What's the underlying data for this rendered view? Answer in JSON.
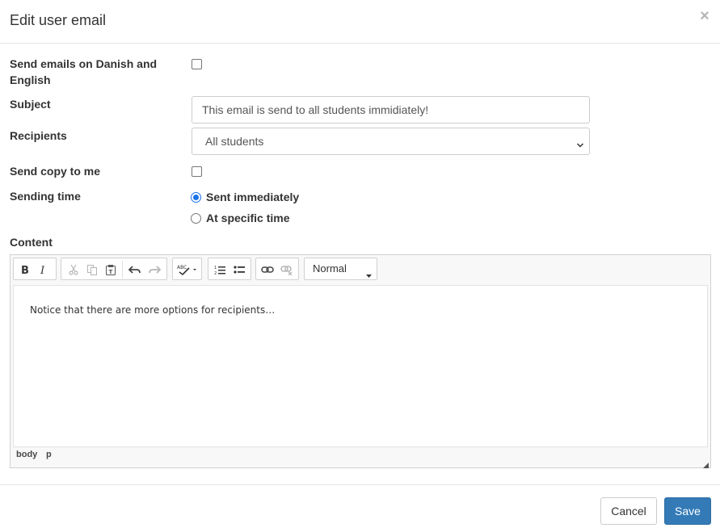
{
  "header": {
    "title": "Edit user email",
    "close_symbol": "×"
  },
  "form": {
    "bilingual_label": "Send emails on Danish and English",
    "bilingual_checked": false,
    "subject_label": "Subject",
    "subject_value": "This email is send to all students immidiately!",
    "recipients_label": "Recipients",
    "recipients_selected": "All students",
    "copy_label": "Send copy to me",
    "copy_checked": false,
    "sending_time_label": "Sending time",
    "sending_options": [
      {
        "label": "Sent immediately",
        "checked": true
      },
      {
        "label": "At specific time",
        "checked": false
      }
    ],
    "content_label": "Content"
  },
  "editor": {
    "toolbar_icons": [
      "bold-icon",
      "italic-icon",
      "cut-icon",
      "copy-icon",
      "paste-text-icon",
      "undo-icon",
      "redo-icon",
      "spellcheck-icon",
      "numbered-list-icon",
      "bulleted-list-icon",
      "link-icon",
      "unlink-icon"
    ],
    "format_value": "Normal",
    "content": "Notice that there are more options for recipients…",
    "path": [
      "body",
      "p"
    ]
  },
  "footer": {
    "cancel_label": "Cancel",
    "save_label": "Save"
  },
  "colors": {
    "primary": "#337ab7",
    "radio_accent": "#1a73e8",
    "border": "#cccccc"
  }
}
